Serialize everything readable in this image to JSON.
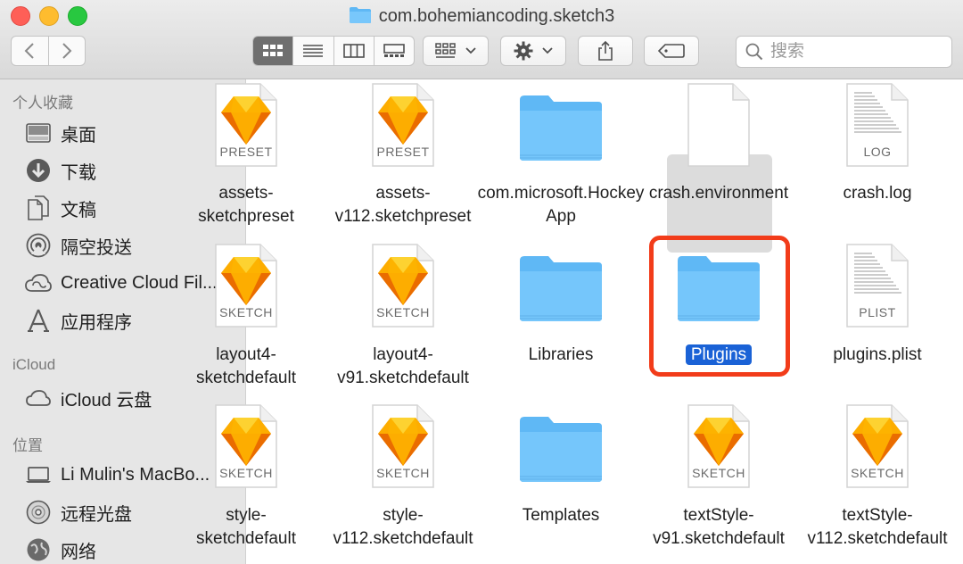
{
  "window": {
    "title": "com.bohemiancoding.sketch3"
  },
  "search": {
    "placeholder": "搜索"
  },
  "sidebar": {
    "sections": [
      {
        "header": "个人收藏"
      },
      {
        "header": "iCloud"
      },
      {
        "header": "位置"
      }
    ],
    "items": [
      {
        "label": "桌面",
        "icon": "desktop-icon"
      },
      {
        "label": "下载",
        "icon": "download-icon"
      },
      {
        "label": "文稿",
        "icon": "documents-icon"
      },
      {
        "label": "隔空投送",
        "icon": "airdrop-icon"
      },
      {
        "label": "Creative Cloud Fil...",
        "icon": "creative-cloud-icon"
      },
      {
        "label": "应用程序",
        "icon": "applications-icon"
      },
      {
        "label": "iCloud 云盘",
        "icon": "icloud-icon"
      },
      {
        "label": "Li Mulin's MacBo...",
        "icon": "laptop-icon"
      },
      {
        "label": "远程光盘",
        "icon": "remote-disc-icon"
      },
      {
        "label": "网络",
        "icon": "network-icon"
      }
    ]
  },
  "files": [
    {
      "name": "assets-\nsketchpreset",
      "ext": "PRESET",
      "kind": "sketch"
    },
    {
      "name": "assets-\nv112.sketchpreset",
      "ext": "PRESET",
      "kind": "sketch"
    },
    {
      "name": "com.microsoft.HockeyApp",
      "kind": "folder"
    },
    {
      "name": "crash.environment",
      "kind": "blank"
    },
    {
      "name": "crash.log",
      "ext": "LOG",
      "kind": "text"
    },
    {
      "name": "layout4-\nsketchdefault",
      "ext": "SKETCH",
      "kind": "sketch"
    },
    {
      "name": "layout4-\nv91.sketchdefault",
      "ext": "SKETCH",
      "kind": "sketch"
    },
    {
      "name": "Libraries",
      "kind": "folder"
    },
    {
      "name": "Plugins",
      "kind": "folder",
      "selected": true
    },
    {
      "name": "plugins.plist",
      "ext": "PLIST",
      "kind": "text"
    },
    {
      "name": "style-\nsketchdefault",
      "ext": "SKETCH",
      "kind": "sketch"
    },
    {
      "name": "style-\nv112.sketchdefault",
      "ext": "SKETCH",
      "kind": "sketch"
    },
    {
      "name": "Templates",
      "kind": "folder"
    },
    {
      "name": "textStyle-\nv91.sketchdefault",
      "ext": "SKETCH",
      "kind": "sketch"
    },
    {
      "name": "textStyle-\nv112.sketchdefault",
      "ext": "SKETCH",
      "kind": "sketch"
    }
  ],
  "colors": {
    "accent": "#1a62d6",
    "highlight": "#f23c1a",
    "folder": "#5fb8f5"
  }
}
